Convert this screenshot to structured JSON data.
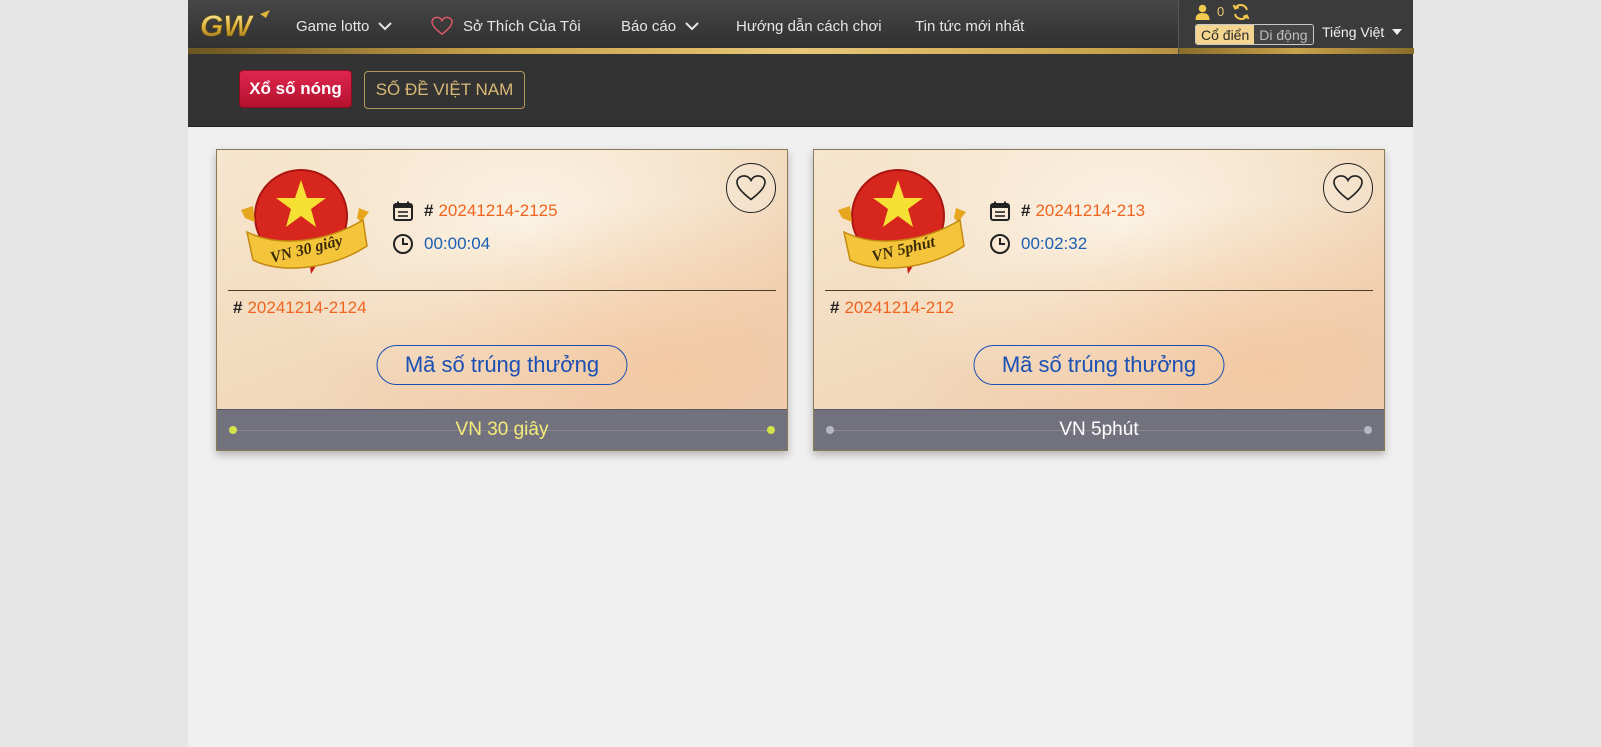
{
  "nav": {
    "logo_text": "GW",
    "items": [
      {
        "label": "Game lotto"
      },
      {
        "label": "Sở Thích Của Tôi"
      },
      {
        "label": "Báo cáo"
      },
      {
        "label": "Hướng dẫn cách chơi"
      },
      {
        "label": "Tin tức mới nhất"
      }
    ]
  },
  "user": {
    "count": "0",
    "mode_classic": "Cổ điển",
    "mode_mobile": "Di động",
    "language": "Tiếng Việt"
  },
  "subnav": {
    "hot_label": "Xổ số nóng",
    "vietnam_label": "SỐ ĐỀ VIỆT NAM"
  },
  "cards": [
    {
      "badge_text": "VN  30 giây",
      "current_issue": "20241214-2125",
      "countdown": "00:00:04",
      "previous_issue": "20241214-2124",
      "winning_button": "Mã số trúng thưởng",
      "title": "VN 30 giây",
      "title_color": "#f5eb7a",
      "dot_color": "#d4e24a"
    },
    {
      "badge_text": "VN 5phút",
      "current_issue": "20241214-213",
      "countdown": "00:02:32",
      "previous_issue": "20241214-212",
      "winning_button": "Mã số trúng thưởng",
      "title": "VN 5phút",
      "title_color": "#ffffff",
      "dot_color": "#b8b8c0"
    }
  ],
  "hash_symbol": "#",
  "colors": {
    "issue": "#f06420",
    "timer": "#1a5fb4",
    "hot_button": "#d01c40",
    "gold": "#c9a24c"
  }
}
